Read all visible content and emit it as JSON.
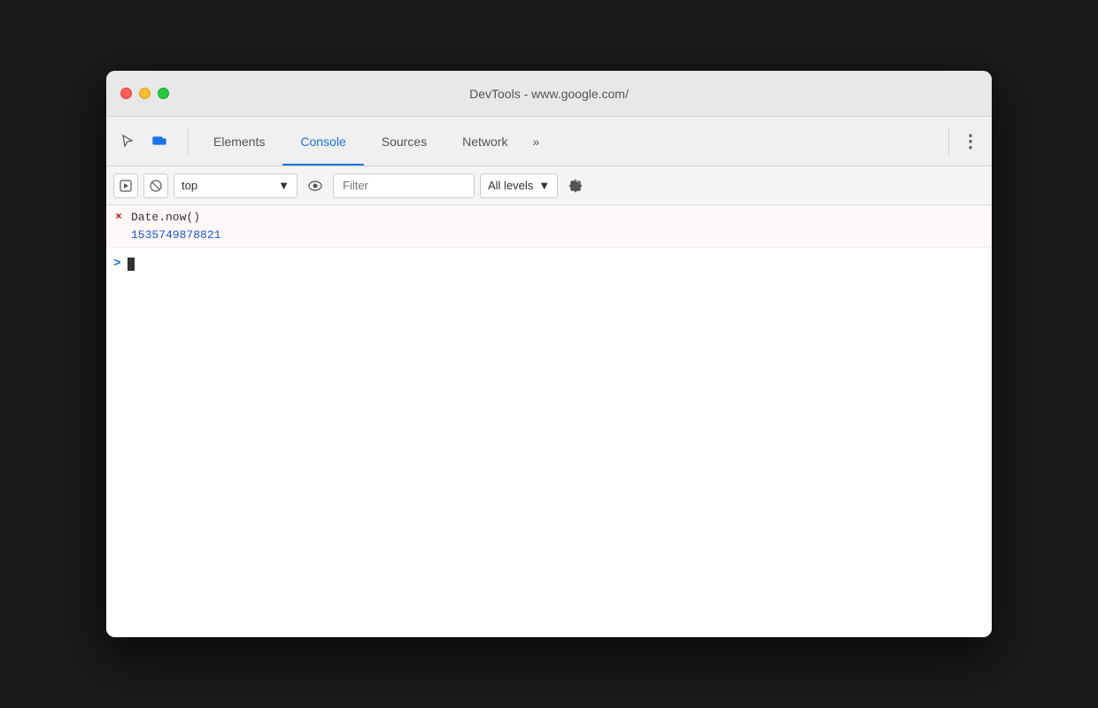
{
  "window": {
    "title": "DevTools - www.google.com/",
    "traffic_lights": {
      "close_label": "close",
      "minimize_label": "minimize",
      "maximize_label": "maximize"
    }
  },
  "toolbar": {
    "inspector_icon": "cursor-icon",
    "device_icon": "device-toolbar-icon",
    "tabs": [
      {
        "id": "elements",
        "label": "Elements",
        "active": false
      },
      {
        "id": "console",
        "label": "Console",
        "active": true
      },
      {
        "id": "sources",
        "label": "Sources",
        "active": false
      },
      {
        "id": "network",
        "label": "Network",
        "active": false
      }
    ],
    "more_tabs_label": "»",
    "menu_label": "⋮"
  },
  "console_toolbar": {
    "execute_btn_label": "▶",
    "clear_btn_label": "🚫",
    "context_value": "top",
    "context_placeholder": "top",
    "filter_placeholder": "Filter",
    "filter_value": "",
    "levels_label": "All levels",
    "levels_arrow": "▼"
  },
  "console": {
    "entries": [
      {
        "type": "input",
        "icon": "×",
        "text": "Date.now()"
      },
      {
        "type": "output",
        "text": "1535749878821"
      }
    ],
    "prompt_arrow": ">"
  }
}
